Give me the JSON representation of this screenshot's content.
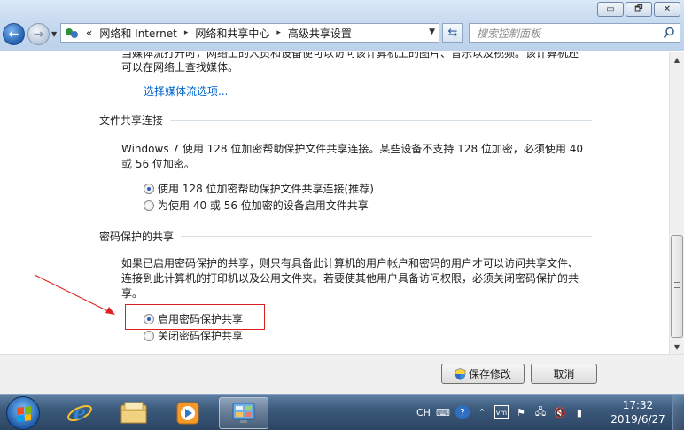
{
  "window": {
    "minimize_glyph": "▭",
    "restore_glyph": "🗗",
    "close_glyph": "✕"
  },
  "addressbar": {
    "overflow": "«",
    "crumbs": [
      "网络和 Internet",
      "网络和共享中心",
      "高级共享设置"
    ],
    "separator": "▸"
  },
  "search": {
    "placeholder": "搜索控制面板"
  },
  "content": {
    "top_text_line1": "当媒体流打开时，网络上的人员和设备便可以访问该计算机上的图片、音乐以及视频。该计算机还",
    "top_text_line2": "可以在网络上查找媒体。",
    "media_link": "选择媒体流选项...",
    "file_sharing": {
      "title": "文件共享连接",
      "desc_line1": "Windows 7 使用 128 位加密帮助保护文件共享连接。某些设备不支持 128 位加密，必须使用 40",
      "desc_line2": "或 56 位加密。",
      "options": [
        "使用 128 位加密帮助保护文件共享连接(推荐)",
        "为使用 40 或 56 位加密的设备启用文件共享"
      ],
      "selected": 0
    },
    "password_sharing": {
      "title": "密码保护的共享",
      "desc_line1": "如果已启用密码保护的共享，则只有具备此计算机的用户帐户和密码的用户才可以访问共享文件、",
      "desc_line2": "连接到此计算机的打印机以及公用文件夹。若要使其他用户具备访问权限，必须关闭密码保护的共",
      "desc_line3": "享。",
      "options": [
        "启用密码保护共享",
        "关闭密码保护共享"
      ],
      "selected": 0
    }
  },
  "buttons": {
    "save": "保存修改",
    "cancel": "取消"
  },
  "taskbar": {
    "tray_lang": "CH",
    "time": "17:32",
    "date": "2019/6/27"
  },
  "colors": {
    "annotation": "#e02020",
    "link": "#0066cc"
  }
}
